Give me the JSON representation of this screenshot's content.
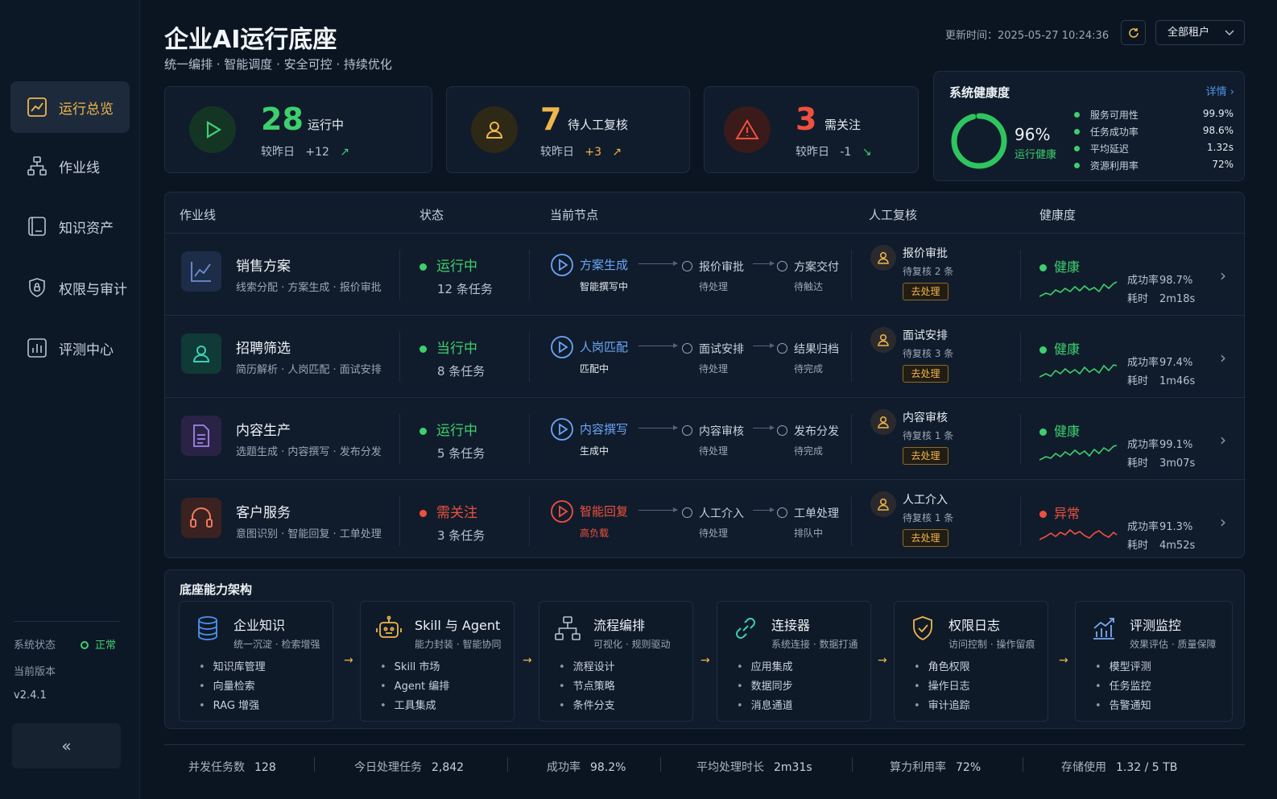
{
  "sidebar": {
    "items": [
      {
        "label": "运行总览",
        "icon": "chart-line-icon"
      },
      {
        "label": "作业线",
        "icon": "hierarchy-icon"
      },
      {
        "label": "知识资产",
        "icon": "book-icon"
      },
      {
        "label": "权限与审计",
        "icon": "shield-icon"
      },
      {
        "label": "评测中心",
        "icon": "bar-chart-icon"
      }
    ],
    "system_status_label": "系统状态",
    "system_status_value": "正常",
    "version_label": "当前版本",
    "version_value": "v2.4.1",
    "collapse": "«"
  },
  "header": {
    "title": "企业AI运行底座",
    "subtitle": "统一编排 · 智能调度 · 安全可控 · 持续优化",
    "update_label": "更新时间：",
    "update_time": "2025-05-27 10:24:36",
    "tenant": "全部租户"
  },
  "stats": [
    {
      "value": "28",
      "label": "运行中",
      "cmp_label": "较昨日",
      "cmp_value": "+12",
      "trend": "up",
      "color": "#3ecf6e"
    },
    {
      "value": "7",
      "label": "待人工复核",
      "cmp_label": "较昨日",
      "cmp_value": "+3",
      "trend": "up",
      "color": "#f0b64b"
    },
    {
      "value": "3",
      "label": "需关注",
      "cmp_label": "较昨日",
      "cmp_value": "-1",
      "trend": "down",
      "color": "#f0503e"
    }
  ],
  "health": {
    "title": "系统健康度",
    "detail": "详情",
    "percent": 96,
    "percent_text": "96%",
    "status": "运行健康",
    "metrics": [
      {
        "name": "服务可用性",
        "value": "99.9%"
      },
      {
        "name": "任务成功率",
        "value": "98.6%"
      },
      {
        "name": "平均延迟",
        "value": "1.32s"
      },
      {
        "name": "资源利用率",
        "value": "72%"
      }
    ]
  },
  "table": {
    "headers": [
      "作业线",
      "状态",
      "当前节点",
      "人工复核",
      "健康度"
    ],
    "rows": [
      {
        "name": "销售方案",
        "sub": "线索分配 · 方案生成 · 报价审批",
        "icon": "chart-line-icon",
        "icon_bg": "#1d2d47",
        "icon_color": "#6d8fd6",
        "status": "运行中",
        "status_color": "#3ecf6e",
        "tasks": "12 条任务",
        "node": "方案生成",
        "node_state": "智能撰写中",
        "node_color": "#6aa6f8",
        "node_state_color": "#e6ecf2",
        "n2": "报价审批",
        "n2s": "待处理",
        "n3": "方案交付",
        "n3s": "待触达",
        "review": "报价审批",
        "review_sub": "待复核 2 条",
        "review_btn": "去处理",
        "health": "健康",
        "health_color": "#3ecf6e",
        "rate_label": "成功率",
        "rate": "98.7%",
        "time_label": "耗时",
        "time": "2m18s"
      },
      {
        "name": "招聘筛选",
        "sub": "简历解析 · 人岗匹配 · 面试安排",
        "icon": "user-icon",
        "icon_bg": "#0f3a36",
        "icon_color": "#3ccfb8",
        "status": "当行中",
        "status_color": "#3ecf6e",
        "tasks": "8 条任务",
        "node": "人岗匹配",
        "node_state": "匹配中",
        "node_color": "#6aa6f8",
        "node_state_color": "#e6ecf2",
        "n2": "面试安排",
        "n2s": "待处理",
        "n3": "结果归档",
        "n3s": "待完成",
        "review": "面试安排",
        "review_sub": "待复核 3 条",
        "review_btn": "去处理",
        "health": "健康",
        "health_color": "#3ecf6e",
        "rate_label": "成功率",
        "rate": "97.4%",
        "time_label": "耗时",
        "time": "1m46s"
      },
      {
        "name": "内容生产",
        "sub": "选题生成 · 内容撰写 · 发布分发",
        "icon": "document-icon",
        "icon_bg": "#2a2346",
        "icon_color": "#9d86e9",
        "status": "运行中",
        "status_color": "#3ecf6e",
        "tasks": "5 条任务",
        "node": "内容撰写",
        "node_state": "生成中",
        "node_color": "#6aa6f8",
        "node_state_color": "#e6ecf2",
        "n2": "内容审核",
        "n2s": "待处理",
        "n3": "发布分发",
        "n3s": "待完成",
        "review": "内容审核",
        "review_sub": "待复核 1 条",
        "review_btn": "去处理",
        "health": "健康",
        "health_color": "#3ecf6e",
        "rate_label": "成功率",
        "rate": "99.1%",
        "time_label": "耗时",
        "time": "3m07s"
      },
      {
        "name": "客户服务",
        "sub": "意图识别 · 智能回复 · 工单处理",
        "icon": "headset-icon",
        "icon_bg": "#3a2220",
        "icon_color": "#f07a5e",
        "status": "需关注",
        "status_color": "#f0503e",
        "tasks": "3 条任务",
        "node": "智能回复",
        "node_state": "高负载",
        "node_color": "#f0503e",
        "node_state_color": "#f0503e",
        "n2": "人工介入",
        "n2s": "待处理",
        "n3": "工单处理",
        "n3s": "排队中",
        "review": "人工介入",
        "review_sub": "待复核 1 条",
        "review_btn": "去处理",
        "health": "异常",
        "health_color": "#f0503e",
        "rate_label": "成功率",
        "rate": "91.3%",
        "time_label": "耗时",
        "time": "4m52s"
      }
    ]
  },
  "arch": {
    "title": "底座能力架构",
    "items": [
      {
        "title": "企业知识",
        "sub": "统一沉淀 · 检索增强",
        "icon": "database-icon",
        "bullets": [
          "知识库管理",
          "向量检索",
          "RAG 增强"
        ]
      },
      {
        "title": "Skill 与 Agent",
        "sub": "能力封装 · 智能协同",
        "icon": "robot-icon",
        "bullets": [
          "Skill 市场",
          "Agent 编排",
          "工具集成"
        ]
      },
      {
        "title": "流程编排",
        "sub": "可视化 · 规则驱动",
        "icon": "flow-icon",
        "bullets": [
          "流程设计",
          "节点策略",
          "条件分支"
        ]
      },
      {
        "title": "连接器",
        "sub": "系统连接 · 数据打通",
        "icon": "link-icon",
        "bullets": [
          "应用集成",
          "数据同步",
          "消息通道"
        ]
      },
      {
        "title": "权限日志",
        "sub": "访问控制 · 操作留痕",
        "icon": "shield-check-icon",
        "bullets": [
          "角色权限",
          "操作日志",
          "审计追踪"
        ]
      },
      {
        "title": "评测监控",
        "sub": "效果评估 · 质量保障",
        "icon": "trend-chart-icon",
        "bullets": [
          "模型评测",
          "任务监控",
          "告警通知"
        ]
      }
    ]
  },
  "footer": [
    {
      "label": "并发任务数",
      "value": "128"
    },
    {
      "label": "今日处理任务",
      "value": "2,842"
    },
    {
      "label": "成功率",
      "value": "98.2%"
    },
    {
      "label": "平均处理时长",
      "value": "2m31s"
    },
    {
      "label": "算力利用率",
      "value": "72%"
    },
    {
      "label": "存储使用",
      "value": "1.32 / 5 TB"
    }
  ]
}
